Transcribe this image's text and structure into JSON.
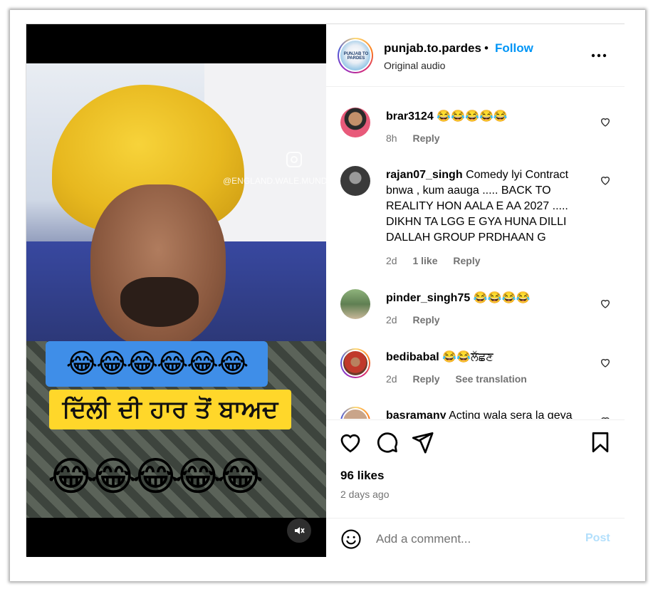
{
  "post": {
    "account": {
      "username": "punjab.to.pardes",
      "separator": "•",
      "follow_label": "Follow",
      "audio_label": "Original audio",
      "avatar_text": "PUNJAB TO PARDES"
    },
    "more_icon": "more-horizontal-icon",
    "media": {
      "watermark": "@ENGLAND.WALE.MUNDEE",
      "emoji_row_top": "😂😂😂😂😂😂",
      "caption_text": "ਦਿੱਲੀ ਦੀ ਹਾਰ ਤੋਂ ਬਾਅਦ",
      "emoji_row_bottom": "😂😂😂😂😂",
      "mute_icon": "speaker-muted-icon"
    },
    "comments": [
      {
        "user": "brar3124",
        "text": "😂😂😂😂😂",
        "time": "8h",
        "likes": "",
        "reply": "Reply",
        "extra": ""
      },
      {
        "user": "rajan07_singh",
        "text": "Comedy lyi Contract bnwa , kum aauga ..... BACK TO REALITY HON AALA E AA 2027 ..... DIKHN TA LGG E GYA HUNA DILLI DALLAH GROUP PRDHAAN G",
        "time": "2d",
        "likes": "1 like",
        "reply": "Reply",
        "extra": ""
      },
      {
        "user": "pinder_singh75",
        "text": "😂😂😂😂",
        "time": "2d",
        "likes": "",
        "reply": "Reply",
        "extra": ""
      },
      {
        "user": "bedibabal",
        "text": "😂😂ਲੱਛਣ",
        "time": "2d",
        "likes": "",
        "reply": "Reply",
        "extra": "See translation"
      },
      {
        "user": "basramany",
        "text": "Acting wala sera la geya",
        "time": "",
        "likes": "",
        "reply": "",
        "extra": ""
      }
    ],
    "actions": {
      "like_icon": "heart-icon",
      "comment_icon": "comment-icon",
      "share_icon": "paper-plane-icon",
      "save_icon": "bookmark-icon"
    },
    "likes_count": "96 likes",
    "posted_ago": "2 days ago",
    "composer": {
      "emoji_icon": "smiley-icon",
      "placeholder": "Add a comment...",
      "post_label": "Post"
    }
  },
  "colors": {
    "accent": "#0095f6",
    "post_disabled": "#b2dffc",
    "muted_text": "#737373"
  }
}
